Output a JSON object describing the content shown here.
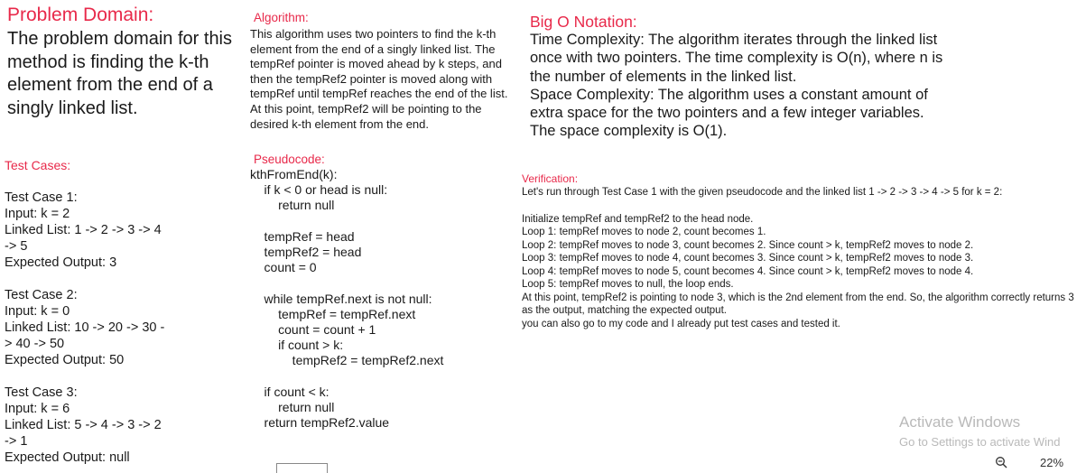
{
  "problem_domain": {
    "title": "Problem Domain:",
    "body": "The problem domain for this method is finding the k-th element from the end of a singly linked list."
  },
  "test_cases": {
    "title": "Test Cases:",
    "cases": [
      {
        "heading": "Test Case 1:",
        "input": "Input: k = 2",
        "list": "Linked List: 1 -> 2 -> 3 -> 4 -> 5",
        "expected": "Expected Output: 3"
      },
      {
        "heading": "Test Case 2:",
        "input": "Input: k = 0",
        "list": "Linked List: 10 -> 20 -> 30 -> 40 -> 50",
        "expected": "Expected Output: 50"
      },
      {
        "heading": "Test Case 3:",
        "input": "Input: k = 6",
        "list": "Linked List: 5 -> 4 -> 3 -> 2 -> 1",
        "expected": "Expected Output: null"
      }
    ]
  },
  "algorithm": {
    "title": "Algorithm:",
    "body": "This algorithm uses two pointers to find the k-th element from the end of a singly linked list. The tempRef pointer is moved ahead by k steps, and then the tempRef2 pointer is moved along with tempRef until tempRef reaches the end of the list. At this point, tempRef2 will be pointing to the desired k-th element from the end."
  },
  "pseudocode": {
    "title": "Pseudocode:",
    "code": "kthFromEnd(k):\n    if k < 0 or head is null:\n        return null\n\n    tempRef = head\n    tempRef2 = head\n    count = 0\n\n    while tempRef.next is not null:\n        tempRef = tempRef.next\n        count = count + 1\n        if count > k:\n            tempRef2 = tempRef2.next\n\n    if count < k:\n        return null\n    return tempRef2.value"
  },
  "big_o": {
    "title": "Big O Notation:",
    "time": "Time Complexity: The algorithm iterates through the linked list once with two pointers. The time complexity is O(n), where n is the number of elements in the linked list.",
    "space": "Space Complexity: The algorithm uses a constant amount of extra space for the two pointers and a few integer variables. The space complexity is O(1)."
  },
  "verification": {
    "title": "Verification:",
    "intro": "Let's run through Test Case 1 with the given pseudocode and the linked list 1 -> 2 -> 3 -> 4 -> 5 for k = 2:",
    "steps": [
      "Initialize tempRef and tempRef2 to the head node.",
      "Loop 1: tempRef moves to node 2, count becomes 1.",
      "Loop 2: tempRef moves to node 3, count becomes 2. Since count > k, tempRef2 moves to node 2.",
      "Loop 3: tempRef moves to node 4, count becomes 3. Since count > k, tempRef2 moves to node 3.",
      "Loop 4: tempRef moves to node 5, count becomes 4. Since count > k, tempRef2 moves to node 4.",
      "Loop 5: tempRef moves to null, the loop ends.",
      "At this point, tempRef2 is pointing to node 3, which is the 2nd element from the end. So, the algorithm correctly returns 3 as the output, matching the expected output.",
      "you can also go to my code and I already put test cases and tested it."
    ]
  },
  "watermark": {
    "title": "Activate Windows",
    "subtitle": "Go to Settings to activate Wind"
  },
  "zoom": {
    "icon": "zoom-out-icon",
    "level": "22%"
  },
  "colors": {
    "heading_red": "#e8294a",
    "body_text": "#1a1a1a",
    "watermark": "#b9b9b9"
  }
}
